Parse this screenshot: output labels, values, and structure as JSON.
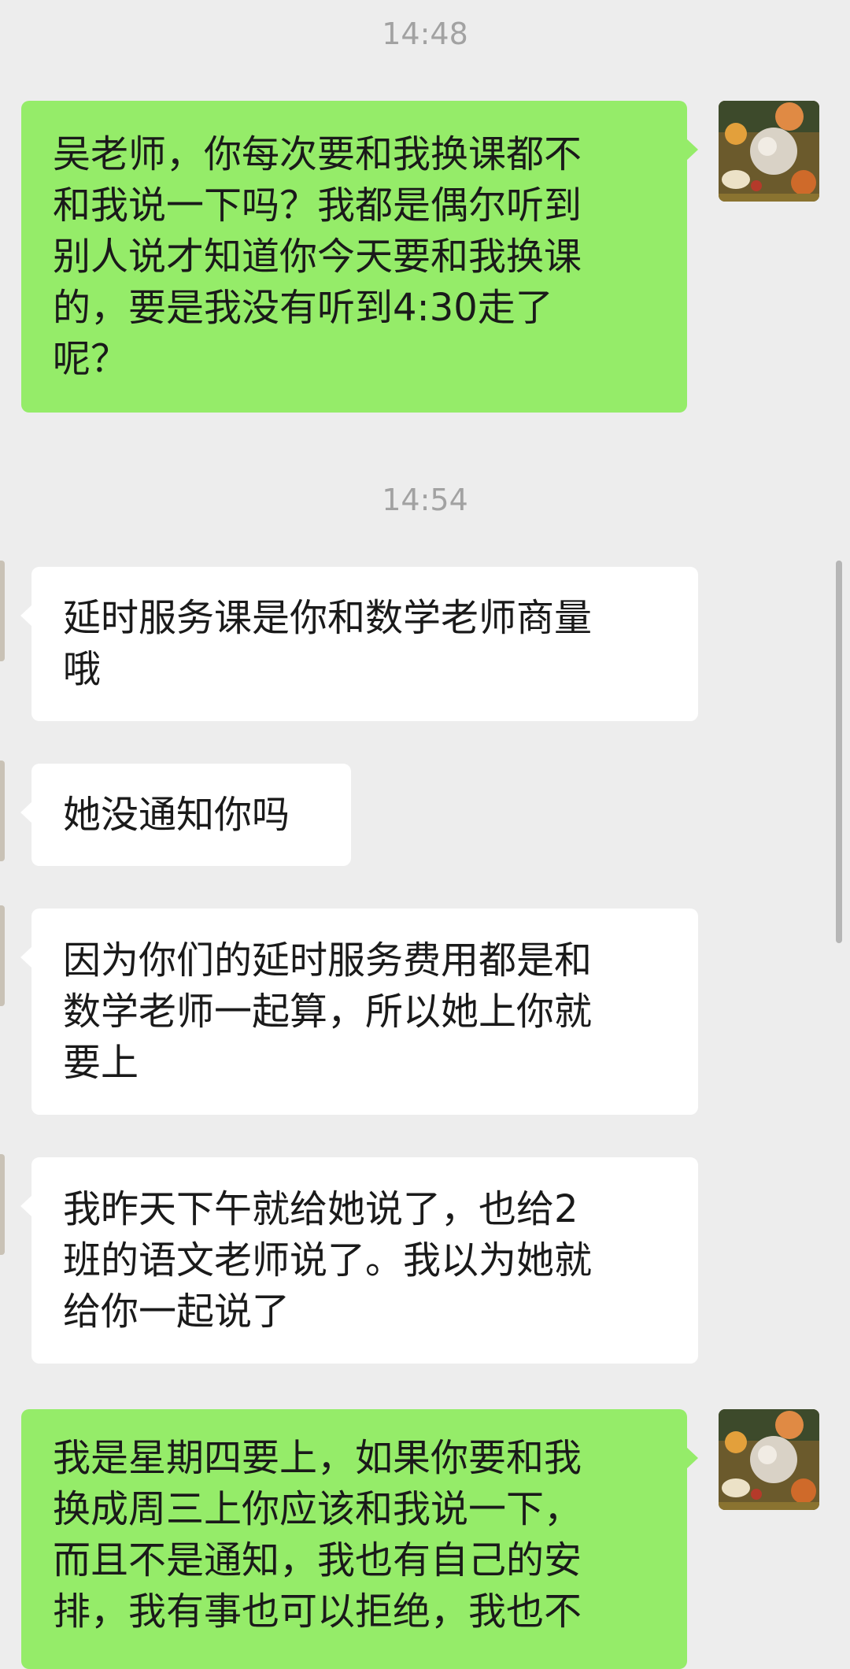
{
  "chat": {
    "timestamps": [
      "14:48",
      "14:54"
    ],
    "messages": [
      {
        "side": "sent",
        "text": "吴老师，你每次要和我换课都不\n和我说一下吗？我都是偶尔听到\n别人说才知道你今天要和我换课\n的，要是我没有听到4:30走了\n呢？"
      },
      {
        "side": "received",
        "text": "延时服务课是你和数学老师商量\n哦"
      },
      {
        "side": "received",
        "text": "她没通知你吗"
      },
      {
        "side": "received",
        "text": "因为你们的延时服务费用都是和\n数学老师一起算，所以她上你就\n要上"
      },
      {
        "side": "received",
        "text": "我昨天下午就给她说了，也给2\n班的语文老师说了。我以为她就\n给你一起说了"
      },
      {
        "side": "sent",
        "text": "我是星期四要上，如果你要和我\n换成周三上你应该和我说一下，\n而且不是通知，我也有自己的安\n排，我有事也可以拒绝，我也不"
      }
    ]
  },
  "colors": {
    "background": "#ededed",
    "sent_bubble": "#95ec69",
    "received_bubble": "#ffffff",
    "timestamp": "#a2a2a2"
  },
  "icons": {
    "self_avatar": "avatar-still-life-icon",
    "other_avatar": "avatar-icon"
  }
}
